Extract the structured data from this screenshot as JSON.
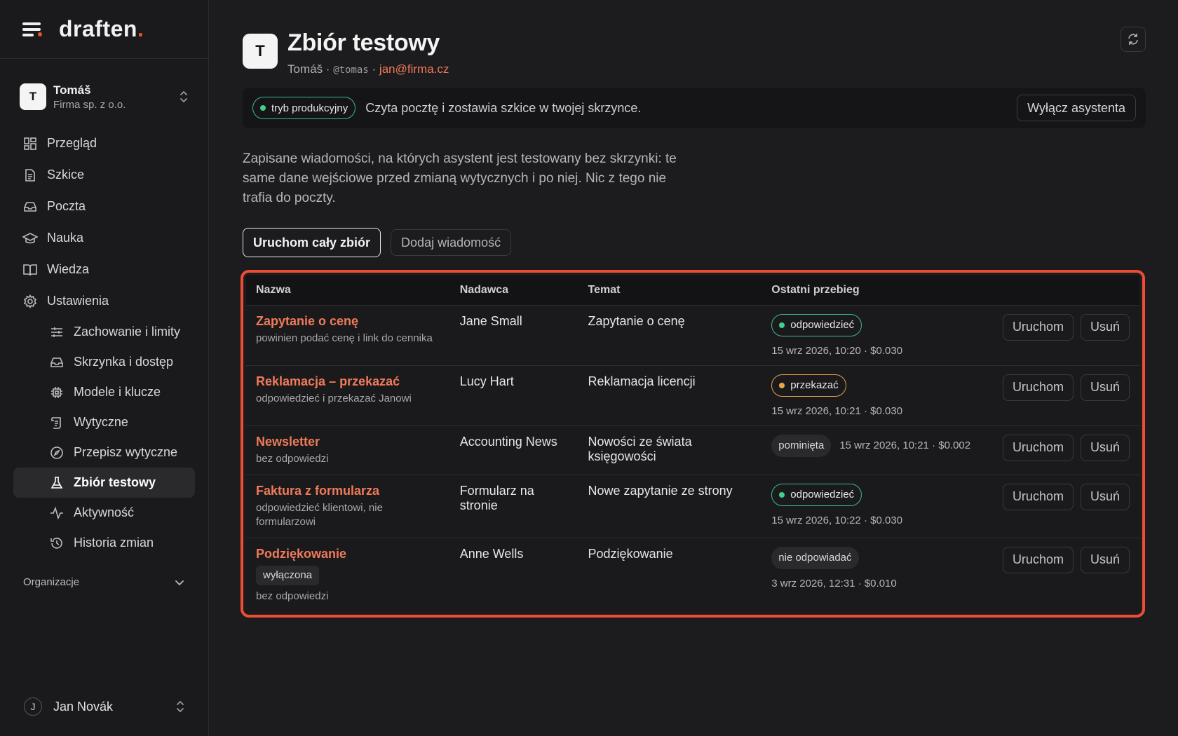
{
  "brand": {
    "name": "draften",
    "dot": "."
  },
  "workspace": {
    "initial": "T",
    "name": "Tomáš",
    "company": "Firma sp. z o.o."
  },
  "nav": [
    {
      "label": "Przegląd",
      "icon": "grid-icon"
    },
    {
      "label": "Szkice",
      "icon": "document-icon"
    },
    {
      "label": "Poczta",
      "icon": "inbox-icon"
    },
    {
      "label": "Nauka",
      "icon": "graduation-cap-icon"
    },
    {
      "label": "Wiedza",
      "icon": "book-icon"
    },
    {
      "label": "Ustawienia",
      "icon": "gear-icon"
    }
  ],
  "subnav": [
    {
      "label": "Zachowanie i limity",
      "icon": "sliders-icon"
    },
    {
      "label": "Skrzynka i dostęp",
      "icon": "inbox-icon"
    },
    {
      "label": "Modele i klucze",
      "icon": "chip-icon"
    },
    {
      "label": "Wytyczne",
      "icon": "scroll-icon"
    },
    {
      "label": "Przepisz wytyczne",
      "icon": "compass-icon"
    },
    {
      "label": "Zbiór testowy",
      "icon": "flask-icon"
    },
    {
      "label": "Aktywność",
      "icon": "activity-icon"
    },
    {
      "label": "Historia zmian",
      "icon": "history-icon"
    }
  ],
  "organizations_label": "Organizacje",
  "user": {
    "initial": "J",
    "name": "Jan Novák"
  },
  "header": {
    "initial": "T",
    "title": "Zbiór testowy",
    "owner": "Tomáš ·",
    "handle": "@tomas",
    "sep": "·",
    "email": "jan@firma.cz"
  },
  "mode": {
    "badge": "tryb produkcyjny",
    "text": "Czyta pocztę i zostawia szkice w twojej skrzynce.",
    "disable_button": "Wyłącz asystenta"
  },
  "description": "Zapisane wiadomości, na których asystent jest testowany bez skrzynki: te same dane wejściowe przed zmianą wytycznych i po niej. Nic z tego nie trafia do poczty.",
  "actions": {
    "run_all": "Uruchom cały zbiór",
    "add_message": "Dodaj wiadomość"
  },
  "table": {
    "columns": [
      "Nazwa",
      "Nadawca",
      "Temat",
      "Ostatni przebieg"
    ],
    "run_label": "Uruchom",
    "delete_label": "Usuń",
    "rows": [
      {
        "name": "Zapytanie o cenę",
        "tag": "",
        "note": "powinien podać cenę i link do cennika",
        "sender": "Jane Small",
        "subject": "Zapytanie o cenę",
        "status": "odpowiedzieć",
        "status_kind": "green",
        "meta": "15 wrz 2026, 10:20 · $0.030",
        "inline": false
      },
      {
        "name": "Reklamacja – przekazać",
        "tag": "",
        "note": "odpowiedzieć i przekazać Janowi",
        "sender": "Lucy Hart",
        "subject": "Reklamacja licencji",
        "status": "przekazać",
        "status_kind": "orange",
        "meta": "15 wrz 2026, 10:21 · $0.030",
        "inline": false
      },
      {
        "name": "Newsletter",
        "tag": "",
        "note": "bez odpowiedzi",
        "sender": "Accounting News",
        "subject": "Nowości ze świata księgowości",
        "status": "pominięta",
        "status_kind": "grey",
        "meta": "15 wrz 2026, 10:21 · $0.002",
        "inline": true
      },
      {
        "name": "Faktura z formularza",
        "tag": "",
        "note": "odpowiedzieć klientowi, nie formularzowi",
        "sender": "Formularz na stronie",
        "subject": "Nowe zapytanie ze strony",
        "status": "odpowiedzieć",
        "status_kind": "green",
        "meta": "15 wrz 2026, 10:22 · $0.030",
        "inline": false
      },
      {
        "name": "Podziękowanie",
        "tag": "wyłączona",
        "note": "bez odpowiedzi",
        "sender": "Anne Wells",
        "subject": "Podziękowanie",
        "status": "nie odpowiadać",
        "status_kind": "grey",
        "meta": "3 wrz 2026, 12:31 · $0.010",
        "inline": false
      }
    ]
  },
  "colors": {
    "accent": "#e8542f",
    "link": "#f07a5a",
    "green": "#3fcf8e",
    "orange": "#f0a646",
    "highlight": "#ee4d33"
  }
}
